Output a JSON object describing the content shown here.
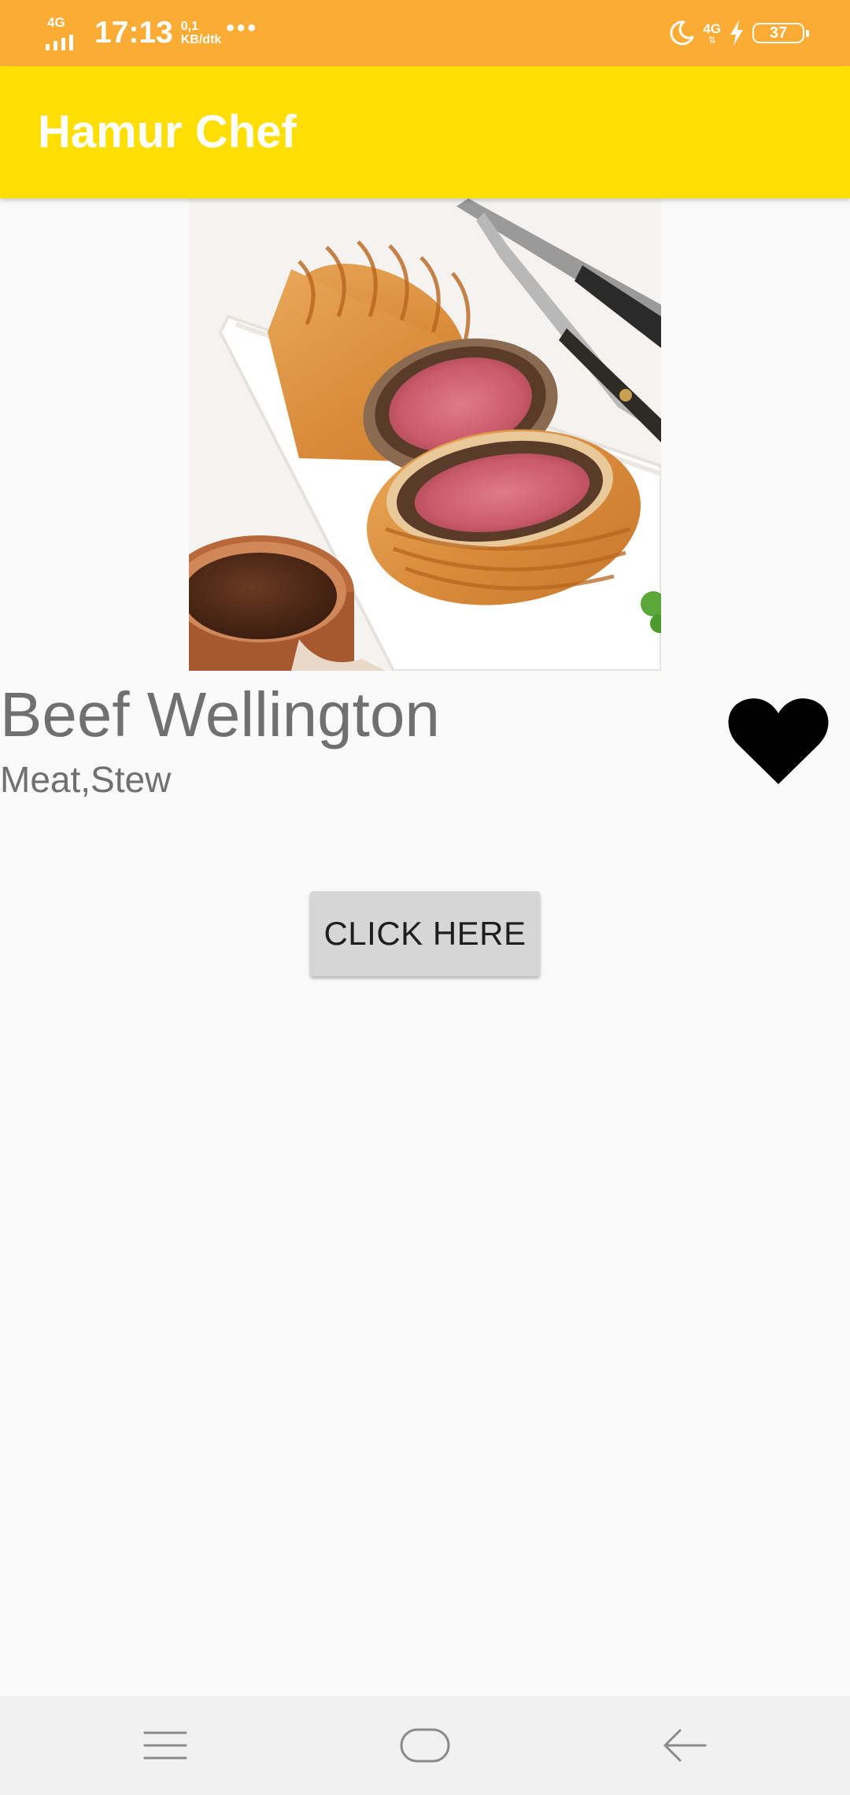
{
  "status_bar": {
    "network_type": "4G",
    "time": "17:13",
    "speed_value": "0,1",
    "speed_unit": "KB/dtk",
    "more_dots": "•••",
    "network_type_right": "4G",
    "battery_level": "37"
  },
  "app_bar": {
    "title": "Hamur Chef"
  },
  "recipe": {
    "name": "Beef Wellington",
    "category": "Meat,Stew",
    "favorite_icon": "heart-icon"
  },
  "actions": {
    "click_label": "CLICK HERE"
  },
  "nav_bar": {
    "icons": [
      "menu-icon",
      "home-icon",
      "back-icon"
    ]
  },
  "colors": {
    "status_bar": "#fbac35",
    "app_bar": "#ffde03",
    "text_gray": "#707070",
    "button_bg": "#d6d6d6"
  }
}
